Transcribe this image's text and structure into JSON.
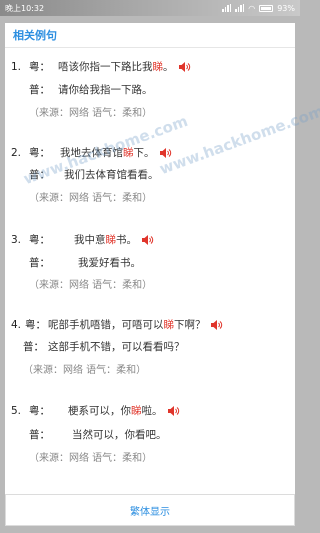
{
  "status": {
    "time": "晚上10:32",
    "battery": "93%"
  },
  "section_title": "相关例句",
  "entries": [
    {
      "num": "1.",
      "yue_label": "粤：",
      "yue_pre": "唔该你指一下路比我",
      "yue_hl": "睇",
      "yue_post": "。",
      "pu_label": "普：",
      "pu_text": "请你给我指一下路。",
      "source": "（来源：网络  语气：柔和）"
    },
    {
      "num": "2.",
      "yue_label": "粤：",
      "yue_pre": "我地去体育馆",
      "yue_hl": "睇",
      "yue_post": "下。",
      "pu_label": "普：",
      "pu_text": "我们去体育馆看看。",
      "source": "（来源：网络  语气：柔和）"
    },
    {
      "num": "3.",
      "yue_label": "粤：",
      "yue_pre": "我中意",
      "yue_hl": "睇",
      "yue_post": "书。",
      "pu_label": "普：",
      "pu_text": "我爱好看书。",
      "source": "（来源：网络  语气：柔和）"
    },
    {
      "num": "4.",
      "yue_label": "粤：",
      "yue_pre": "呢部手机唔错，可唔可以",
      "yue_hl": "睇",
      "yue_post": "下啊？",
      "pu_label": "普：",
      "pu_text": "这部手机不错，可以看看吗？",
      "source": "（来源：网络  语气：柔和）"
    },
    {
      "num": "5.",
      "yue_label": "粤：",
      "yue_pre": "梗系可以，你",
      "yue_hl": "睇",
      "yue_post": "啦。",
      "pu_label": "普：",
      "pu_text": "当然可以，你看吧。",
      "source": "（来源：网络  语气：柔和）"
    }
  ],
  "watermark_text": "www.hackhome.com",
  "bottom_button": "繁体显示",
  "colors": {
    "accent": "#2b8ee0",
    "highlight": "#e0352b"
  }
}
